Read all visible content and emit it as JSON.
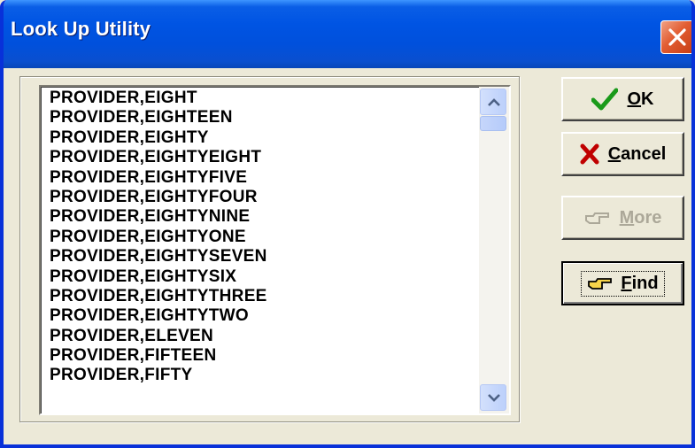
{
  "window": {
    "title": "Look Up Utility",
    "close_icon": "close-x-icon"
  },
  "list": {
    "items": [
      "PROVIDER,EIGHT",
      "PROVIDER,EIGHTEEN",
      "PROVIDER,EIGHTY",
      "PROVIDER,EIGHTYEIGHT",
      "PROVIDER,EIGHTYFIVE",
      "PROVIDER,EIGHTYFOUR",
      "PROVIDER,EIGHTYNINE",
      "PROVIDER,EIGHTYONE",
      "PROVIDER,EIGHTYSEVEN",
      "PROVIDER,EIGHTYSIX",
      "PROVIDER,EIGHTYTHREE",
      "PROVIDER,EIGHTYTWO",
      "PROVIDER,ELEVEN",
      "PROVIDER,FIFTEEN",
      "PROVIDER,FIFTY"
    ]
  },
  "buttons": {
    "ok": {
      "label": "OK",
      "mnemonic": "O",
      "rest": "K",
      "icon": "checkmark-icon",
      "enabled": true
    },
    "cancel": {
      "label": "Cancel",
      "mnemonic": "C",
      "rest": "ancel",
      "icon": "red-x-icon",
      "enabled": true
    },
    "more": {
      "label": "More",
      "mnemonic": "M",
      "rest": "ore",
      "icon": "pointing-hand-icon",
      "enabled": false
    },
    "find": {
      "label": "Find",
      "mnemonic": "F",
      "rest": "ind",
      "icon": "pointing-hand-icon",
      "enabled": true,
      "focused": true
    }
  },
  "colors": {
    "titlebar": "#0054e3",
    "dialog_bg": "#ece9d8",
    "ok_check": "#1a9a1a",
    "cancel_x": "#c00000",
    "disabled_text": "#aca899"
  }
}
